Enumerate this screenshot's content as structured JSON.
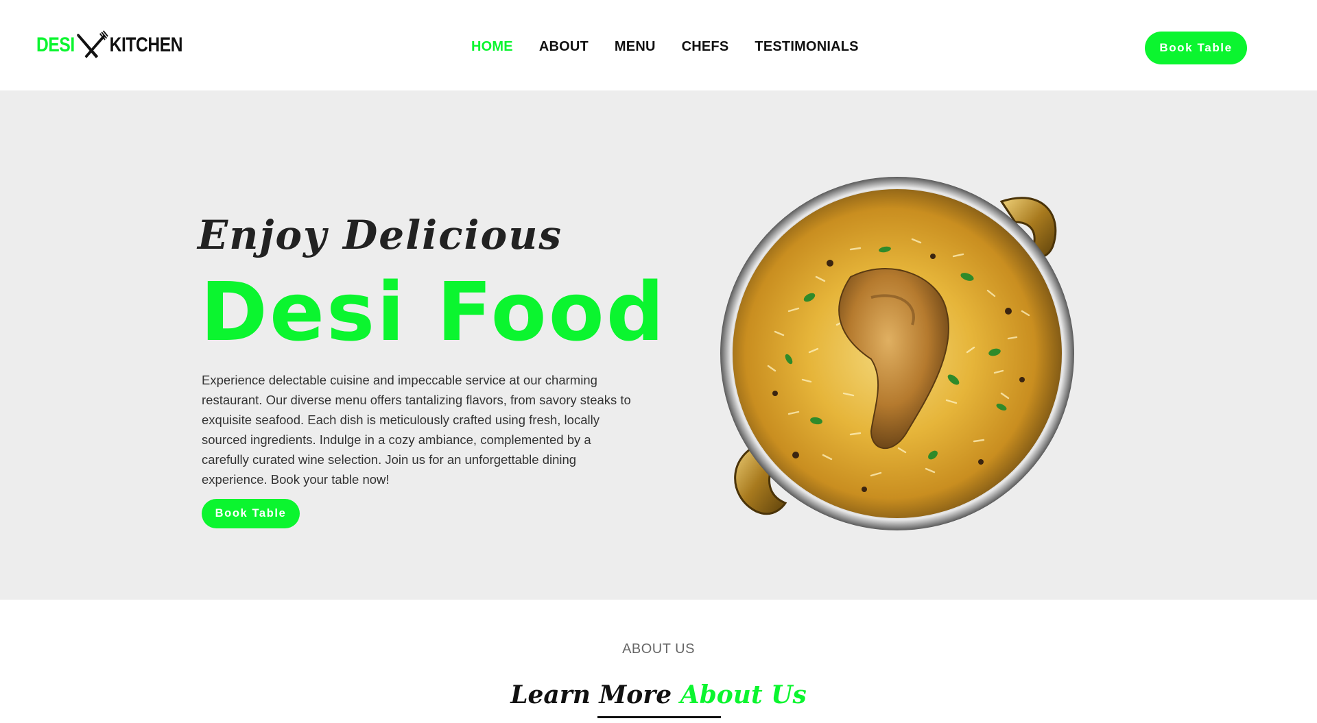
{
  "header": {
    "logo": {
      "part1": "DESI",
      "part2": "KITCHEN"
    },
    "nav": [
      {
        "label": "HOME",
        "active": true
      },
      {
        "label": "ABOUT",
        "active": false
      },
      {
        "label": "MENU",
        "active": false
      },
      {
        "label": "CHEFS",
        "active": false
      },
      {
        "label": "TESTIMONIALS",
        "active": false
      }
    ],
    "cta_label": "Book Table"
  },
  "hero": {
    "script_title": "Enjoy Delicious",
    "title": "Desi Food",
    "description": "Experience delectable cuisine and impeccable service at our charming restaurant. Our diverse menu offers tantalizing flavors, from savory steaks to exquisite seafood. Each dish is meticulously crafted using fresh, locally sourced ingredients. Indulge in a cozy ambiance, complemented by a carefully curated wine selection. Join us for an unforgettable dining experience. Book your table now!",
    "cta_label": "Book Table",
    "image": "biryani-dish-image"
  },
  "about": {
    "label": "ABOUT US",
    "heading_part1": "Learn More",
    "heading_part2": "About Us"
  },
  "colors": {
    "accent": "#0bf52f",
    "hero_bg": "#ededed",
    "text": "#111111"
  },
  "icons": [
    "fork-knife-icon"
  ]
}
